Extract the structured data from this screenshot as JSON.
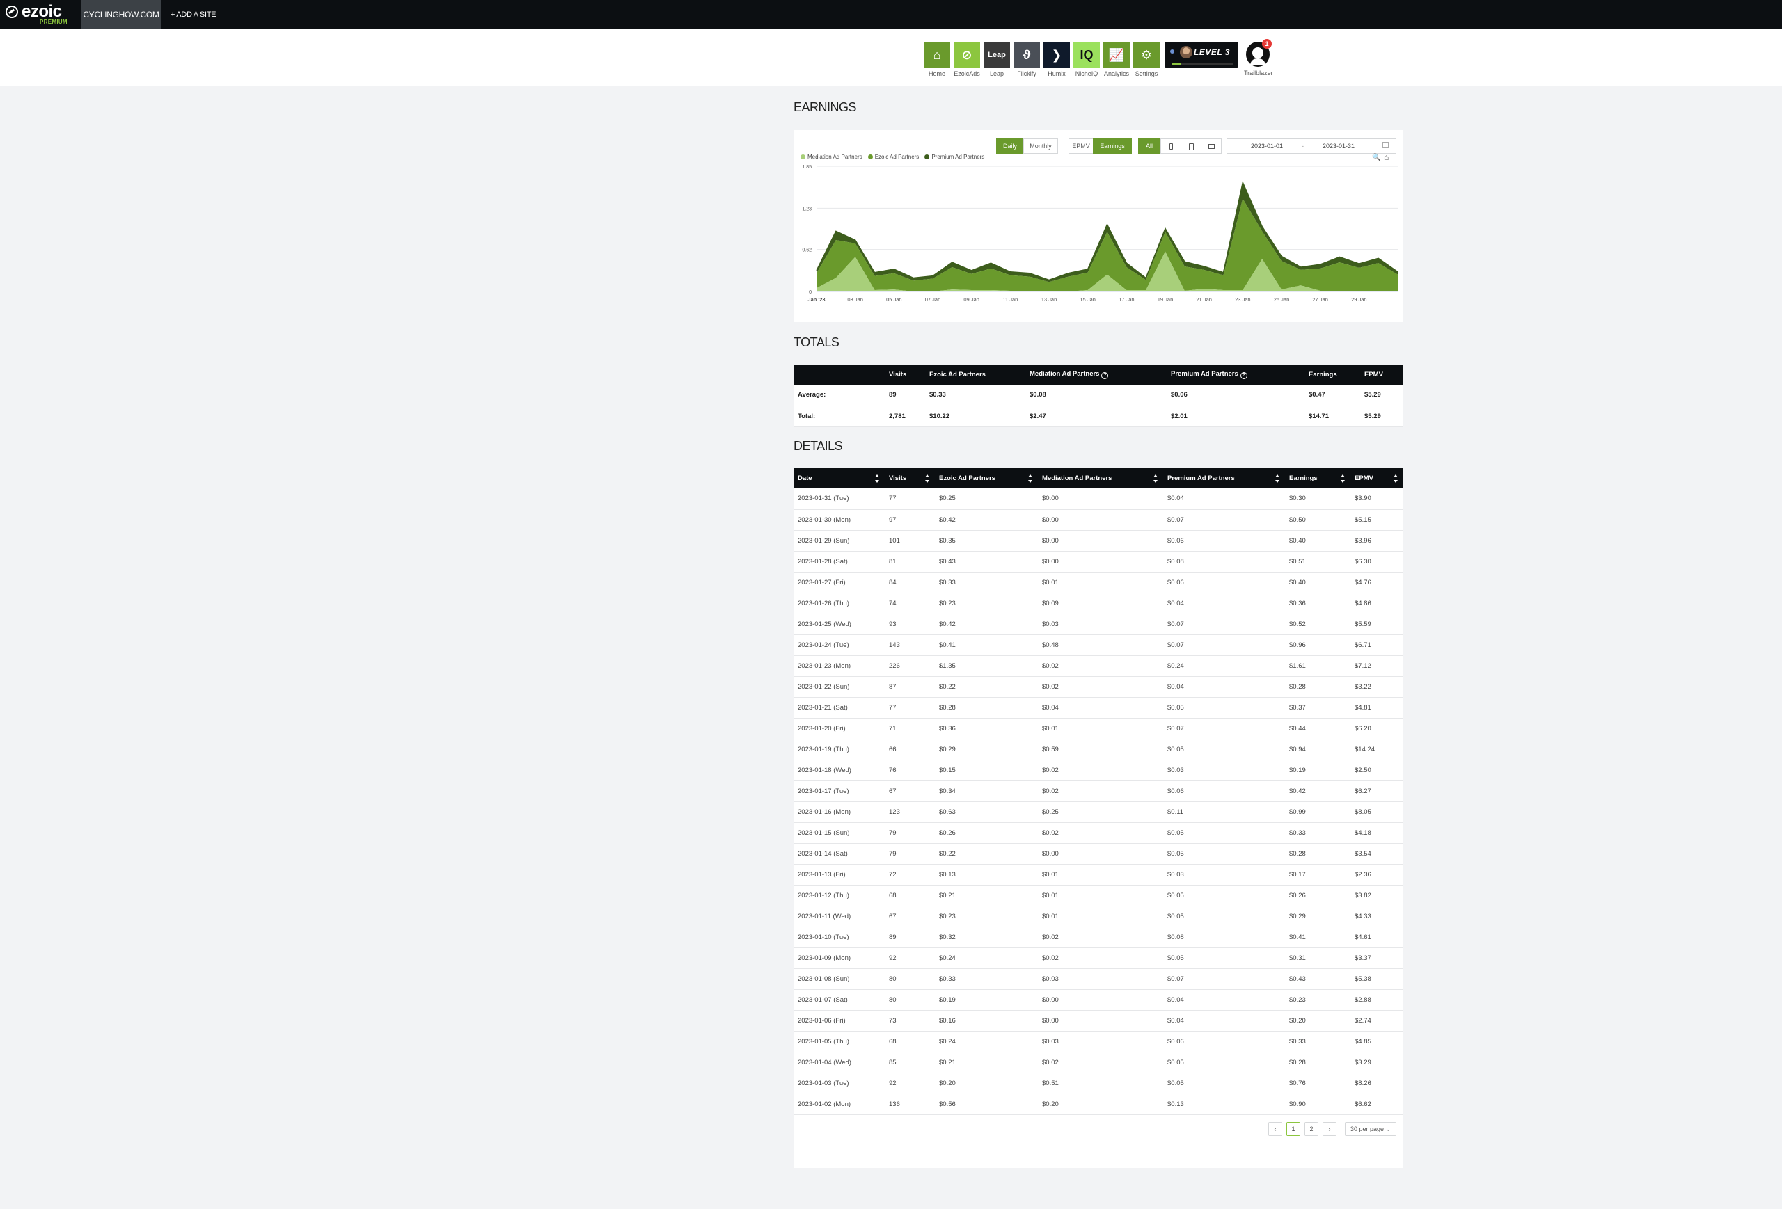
{
  "topbar": {
    "logo_text": "ezoic",
    "logo_sub": "PREMIUM",
    "site_name": "CYCLINGHOW.COM",
    "add_site": "+ ADD A SITE"
  },
  "apps": [
    {
      "label": "Home",
      "glyph": "⌂",
      "color": "#6a9a2c",
      "icon": "home-icon"
    },
    {
      "label": "EzoicAds",
      "glyph": "⊘",
      "color": "#8cc63f",
      "icon": "ezoicads-icon"
    },
    {
      "label": "Leap",
      "glyph": "Leap",
      "color": "#3a3a3a",
      "icon": "leap-icon"
    },
    {
      "label": "Flickify",
      "glyph": "ϑ",
      "color": "#4a4f57",
      "icon": "flickify-icon"
    },
    {
      "label": "Humix",
      "glyph": "❯",
      "color": "#0f1a2b",
      "icon": "humix-icon"
    },
    {
      "label": "NicheIQ",
      "glyph": "IQ",
      "color": "#9be15d",
      "icon": "nicheiq-icon"
    },
    {
      "label": "Analytics",
      "glyph": "📈",
      "color": "#6a9a2c",
      "icon": "analytics-icon"
    },
    {
      "label": "Settings",
      "glyph": "⚙",
      "color": "#6a9a2c",
      "icon": "settings-icon"
    }
  ],
  "level": {
    "text": "LEVEL 3",
    "progress": 0.16
  },
  "trailblazer": {
    "label": "Trailblazer",
    "badge": "1"
  },
  "earnings": {
    "title": "EARNINGS",
    "toggles": {
      "daily": "Daily",
      "monthly": "Monthly",
      "epmv": "EPMV",
      "earnings": "Earnings",
      "all": "All"
    },
    "date_start": "2023-01-01",
    "date_sep": "-",
    "date_end": "2023-01-31",
    "legend": [
      {
        "name": "Mediation Ad Partners",
        "color": "#a8cf7a"
      },
      {
        "name": "Ezoic Ad Partners",
        "color": "#6a9a2c"
      },
      {
        "name": "Premium Ad Partners",
        "color": "#3d5d1c"
      }
    ]
  },
  "chart_data": {
    "type": "area",
    "stacked": true,
    "x": [
      "2023-01-01",
      "2023-01-02",
      "2023-01-03",
      "2023-01-04",
      "2023-01-05",
      "2023-01-06",
      "2023-01-07",
      "2023-01-08",
      "2023-01-09",
      "2023-01-10",
      "2023-01-11",
      "2023-01-12",
      "2023-01-13",
      "2023-01-14",
      "2023-01-15",
      "2023-01-16",
      "2023-01-17",
      "2023-01-18",
      "2023-01-19",
      "2023-01-20",
      "2023-01-21",
      "2023-01-22",
      "2023-01-23",
      "2023-01-24",
      "2023-01-25",
      "2023-01-26",
      "2023-01-27",
      "2023-01-28",
      "2023-01-29",
      "2023-01-30",
      "2023-01-31"
    ],
    "xticks": [
      "Jan '23",
      "03 Jan",
      "05 Jan",
      "07 Jan",
      "09 Jan",
      "11 Jan",
      "13 Jan",
      "15 Jan",
      "17 Jan",
      "19 Jan",
      "21 Jan",
      "23 Jan",
      "25 Jan",
      "27 Jan",
      "29 Jan"
    ],
    "yticks": [
      "0",
      "0.62",
      "1.23",
      "1.85"
    ],
    "ylim": [
      0,
      1.85
    ],
    "series": [
      {
        "name": "Mediation Ad Partners",
        "color": "#a8cf7a",
        "values": [
          0.05,
          0.2,
          0.51,
          0.02,
          0.03,
          0.0,
          0.0,
          0.03,
          0.02,
          0.02,
          0.01,
          0.01,
          0.01,
          0.0,
          0.02,
          0.25,
          0.02,
          0.02,
          0.59,
          0.01,
          0.04,
          0.02,
          0.02,
          0.48,
          0.03,
          0.09,
          0.01,
          0.0,
          0.0,
          0.0,
          0.0
        ]
      },
      {
        "name": "Ezoic Ad Partners",
        "color": "#6a9a2c",
        "values": [
          0.22,
          0.56,
          0.2,
          0.21,
          0.24,
          0.16,
          0.19,
          0.33,
          0.24,
          0.32,
          0.23,
          0.21,
          0.13,
          0.22,
          0.26,
          0.63,
          0.34,
          0.15,
          0.29,
          0.36,
          0.28,
          0.22,
          1.35,
          0.41,
          0.42,
          0.23,
          0.33,
          0.43,
          0.35,
          0.42,
          0.25
        ]
      },
      {
        "name": "Premium Ad Partners",
        "color": "#3d5d1c",
        "values": [
          0.04,
          0.13,
          0.05,
          0.05,
          0.06,
          0.04,
          0.04,
          0.07,
          0.05,
          0.08,
          0.05,
          0.05,
          0.03,
          0.05,
          0.05,
          0.11,
          0.06,
          0.03,
          0.05,
          0.07,
          0.05,
          0.04,
          0.24,
          0.07,
          0.07,
          0.04,
          0.06,
          0.08,
          0.06,
          0.07,
          0.04
        ]
      }
    ]
  },
  "totals": {
    "title": "TOTALS",
    "headers": [
      "",
      "Visits",
      "Ezoic Ad Partners",
      "Mediation Ad Partners",
      "Premium Ad Partners",
      "Earnings",
      "EPMV"
    ],
    "rows": [
      [
        "Average:",
        "89",
        "$0.33",
        "$0.08",
        "$0.06",
        "$0.47",
        "$5.29"
      ],
      [
        "Total:",
        "2,781",
        "$10.22",
        "$2.47",
        "$2.01",
        "$14.71",
        "$5.29"
      ]
    ]
  },
  "details": {
    "title": "DETAILS",
    "headers": [
      "Date",
      "Visits",
      "Ezoic Ad Partners",
      "Mediation Ad Partners",
      "Premium Ad Partners",
      "Earnings",
      "EPMV"
    ],
    "rows": [
      [
        "2023-01-31 (Tue)",
        "77",
        "$0.25",
        "$0.00",
        "$0.04",
        "$0.30",
        "$3.90"
      ],
      [
        "2023-01-30 (Mon)",
        "97",
        "$0.42",
        "$0.00",
        "$0.07",
        "$0.50",
        "$5.15"
      ],
      [
        "2023-01-29 (Sun)",
        "101",
        "$0.35",
        "$0.00",
        "$0.06",
        "$0.40",
        "$3.96"
      ],
      [
        "2023-01-28 (Sat)",
        "81",
        "$0.43",
        "$0.00",
        "$0.08",
        "$0.51",
        "$6.30"
      ],
      [
        "2023-01-27 (Fri)",
        "84",
        "$0.33",
        "$0.01",
        "$0.06",
        "$0.40",
        "$4.76"
      ],
      [
        "2023-01-26 (Thu)",
        "74",
        "$0.23",
        "$0.09",
        "$0.04",
        "$0.36",
        "$4.86"
      ],
      [
        "2023-01-25 (Wed)",
        "93",
        "$0.42",
        "$0.03",
        "$0.07",
        "$0.52",
        "$5.59"
      ],
      [
        "2023-01-24 (Tue)",
        "143",
        "$0.41",
        "$0.48",
        "$0.07",
        "$0.96",
        "$6.71"
      ],
      [
        "2023-01-23 (Mon)",
        "226",
        "$1.35",
        "$0.02",
        "$0.24",
        "$1.61",
        "$7.12"
      ],
      [
        "2023-01-22 (Sun)",
        "87",
        "$0.22",
        "$0.02",
        "$0.04",
        "$0.28",
        "$3.22"
      ],
      [
        "2023-01-21 (Sat)",
        "77",
        "$0.28",
        "$0.04",
        "$0.05",
        "$0.37",
        "$4.81"
      ],
      [
        "2023-01-20 (Fri)",
        "71",
        "$0.36",
        "$0.01",
        "$0.07",
        "$0.44",
        "$6.20"
      ],
      [
        "2023-01-19 (Thu)",
        "66",
        "$0.29",
        "$0.59",
        "$0.05",
        "$0.94",
        "$14.24"
      ],
      [
        "2023-01-18 (Wed)",
        "76",
        "$0.15",
        "$0.02",
        "$0.03",
        "$0.19",
        "$2.50"
      ],
      [
        "2023-01-17 (Tue)",
        "67",
        "$0.34",
        "$0.02",
        "$0.06",
        "$0.42",
        "$6.27"
      ],
      [
        "2023-01-16 (Mon)",
        "123",
        "$0.63",
        "$0.25",
        "$0.11",
        "$0.99",
        "$8.05"
      ],
      [
        "2023-01-15 (Sun)",
        "79",
        "$0.26",
        "$0.02",
        "$0.05",
        "$0.33",
        "$4.18"
      ],
      [
        "2023-01-14 (Sat)",
        "79",
        "$0.22",
        "$0.00",
        "$0.05",
        "$0.28",
        "$3.54"
      ],
      [
        "2023-01-13 (Fri)",
        "72",
        "$0.13",
        "$0.01",
        "$0.03",
        "$0.17",
        "$2.36"
      ],
      [
        "2023-01-12 (Thu)",
        "68",
        "$0.21",
        "$0.01",
        "$0.05",
        "$0.26",
        "$3.82"
      ],
      [
        "2023-01-11 (Wed)",
        "67",
        "$0.23",
        "$0.01",
        "$0.05",
        "$0.29",
        "$4.33"
      ],
      [
        "2023-01-10 (Tue)",
        "89",
        "$0.32",
        "$0.02",
        "$0.08",
        "$0.41",
        "$4.61"
      ],
      [
        "2023-01-09 (Mon)",
        "92",
        "$0.24",
        "$0.02",
        "$0.05",
        "$0.31",
        "$3.37"
      ],
      [
        "2023-01-08 (Sun)",
        "80",
        "$0.33",
        "$0.03",
        "$0.07",
        "$0.43",
        "$5.38"
      ],
      [
        "2023-01-07 (Sat)",
        "80",
        "$0.19",
        "$0.00",
        "$0.04",
        "$0.23",
        "$2.88"
      ],
      [
        "2023-01-06 (Fri)",
        "73",
        "$0.16",
        "$0.00",
        "$0.04",
        "$0.20",
        "$2.74"
      ],
      [
        "2023-01-05 (Thu)",
        "68",
        "$0.24",
        "$0.03",
        "$0.06",
        "$0.33",
        "$4.85"
      ],
      [
        "2023-01-04 (Wed)",
        "85",
        "$0.21",
        "$0.02",
        "$0.05",
        "$0.28",
        "$3.29"
      ],
      [
        "2023-01-03 (Tue)",
        "92",
        "$0.20",
        "$0.51",
        "$0.05",
        "$0.76",
        "$8.26"
      ],
      [
        "2023-01-02 (Mon)",
        "136",
        "$0.56",
        "$0.20",
        "$0.13",
        "$0.90",
        "$6.62"
      ]
    ]
  },
  "pagination": {
    "prev": "‹",
    "pages": [
      "1",
      "2"
    ],
    "next": "›",
    "per_page": "30 per page"
  }
}
